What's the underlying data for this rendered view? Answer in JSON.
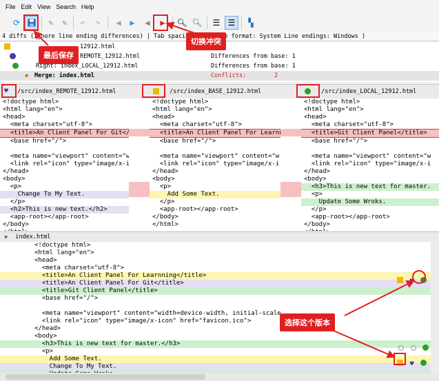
{
  "menu": [
    "File",
    "Edit",
    "View",
    "Search",
    "Help"
  ],
  "status_bar": "4 diffs (Ignore line ending differences) | Tab spacing: 4 | File format: System  Line endings: Windows ) ",
  "tree": {
    "base_file": "Base: index_BASE_12912.html",
    "remote_file": "Remote: index_REMOTE_12912.html",
    "remote_short": "REMOTE_12912.html",
    "right_file": "Right: index_LOCAL_12912.html",
    "merge_file": "Merge: index.html",
    "diff_from_base_1": "Differences from base: 1",
    "diff_from_base_2": "Differences from base: 1",
    "conflicts_label": "Conflicts:",
    "conflicts_count": "2",
    "top_value": "12912.html"
  },
  "panes": {
    "left_path": "/src/index_REMOTE_12912.html",
    "middle_path": "/src/index_BASE_12912.html",
    "right_path": "/src/index_LOCAL_12912.html",
    "left": [
      "<!doctype html>",
      "<html lang=\"en\">",
      "<head>",
      "  <meta charset=\"utf-8\">",
      "  <title>An Client Panel For Git</title>",
      "  <base href=\"/\">",
      "",
      "  <meta name=\"viewport\" content=\"w",
      "  <link rel=\"icon\" type=\"image/x-i",
      "</head>",
      "<body>",
      "  <p>",
      "    Change To My Text.",
      "  </p>",
      "  <h2>This is new text.</h2>",
      "  <app-root></app-root>",
      "</body>",
      "</html>"
    ],
    "middle": [
      "<!doctype html>",
      "<html lang=\"en\">",
      "<head>",
      "  <meta charset=\"utf-8\">",
      "  <title>An Client Panel For Learnn",
      "  <base href=\"/\">",
      "",
      "  <meta name=\"viewport\" content=\"w",
      "  <link rel=\"icon\" type=\"image/x-i",
      "</head>",
      "<body>",
      "  <p>",
      "    Add Some Text.",
      "  </p>",
      "  <app-root></app-root>",
      "</body>",
      "</html>"
    ],
    "right": [
      "<!doctype html>",
      "<html lang=\"en\">",
      "<head>",
      "  <meta charset=\"utf-8\">",
      "  <title>Git Client Panel</title>",
      "  <base href=\"/\">",
      "",
      "  <meta name=\"viewport\" content=\"w",
      "  <link rel=\"icon\" type=\"image/x-i",
      "</head>",
      "<body>",
      "  <h3>This is new text for master.",
      "  <p>",
      "    Update Some Wroks.",
      "  </p>",
      "  <app-root></app-root>",
      "</body>",
      "</html>"
    ]
  },
  "merge": {
    "title": "index.html",
    "lines": [
      "<!doctype html>",
      "<html lang=\"en\">",
      "<head>",
      "  <meta charset=\"utf-8\">",
      "  <title>An Client Panel For Learnning</title>",
      "  <title>An Client Panel For Git</title>",
      "  <title>Git Client Panel</title>",
      "  <base href=\"/\">",
      "",
      "  <meta name=\"viewport\" content=\"width=device-width, initial-scale",
      "  <link rel=\"icon\" type=\"image/x-icon\" href=\"favicon.ico\">",
      "</head>",
      "<body>",
      "  <h3>This is new text for master.</h3>",
      "  <p>",
      "    Add Some Text.",
      "    Change To My Text.",
      "    Update Some Wroks."
    ]
  },
  "callouts": {
    "last_save": "最后保存",
    "switch_conflict": "切换冲突",
    "choose_version": "选择这个版本"
  },
  "colors": {
    "accent_red": "#e02020",
    "base_yellow": "#f5b800",
    "remote_purple": "#4a3aa0",
    "local_green": "#2aa02a"
  }
}
